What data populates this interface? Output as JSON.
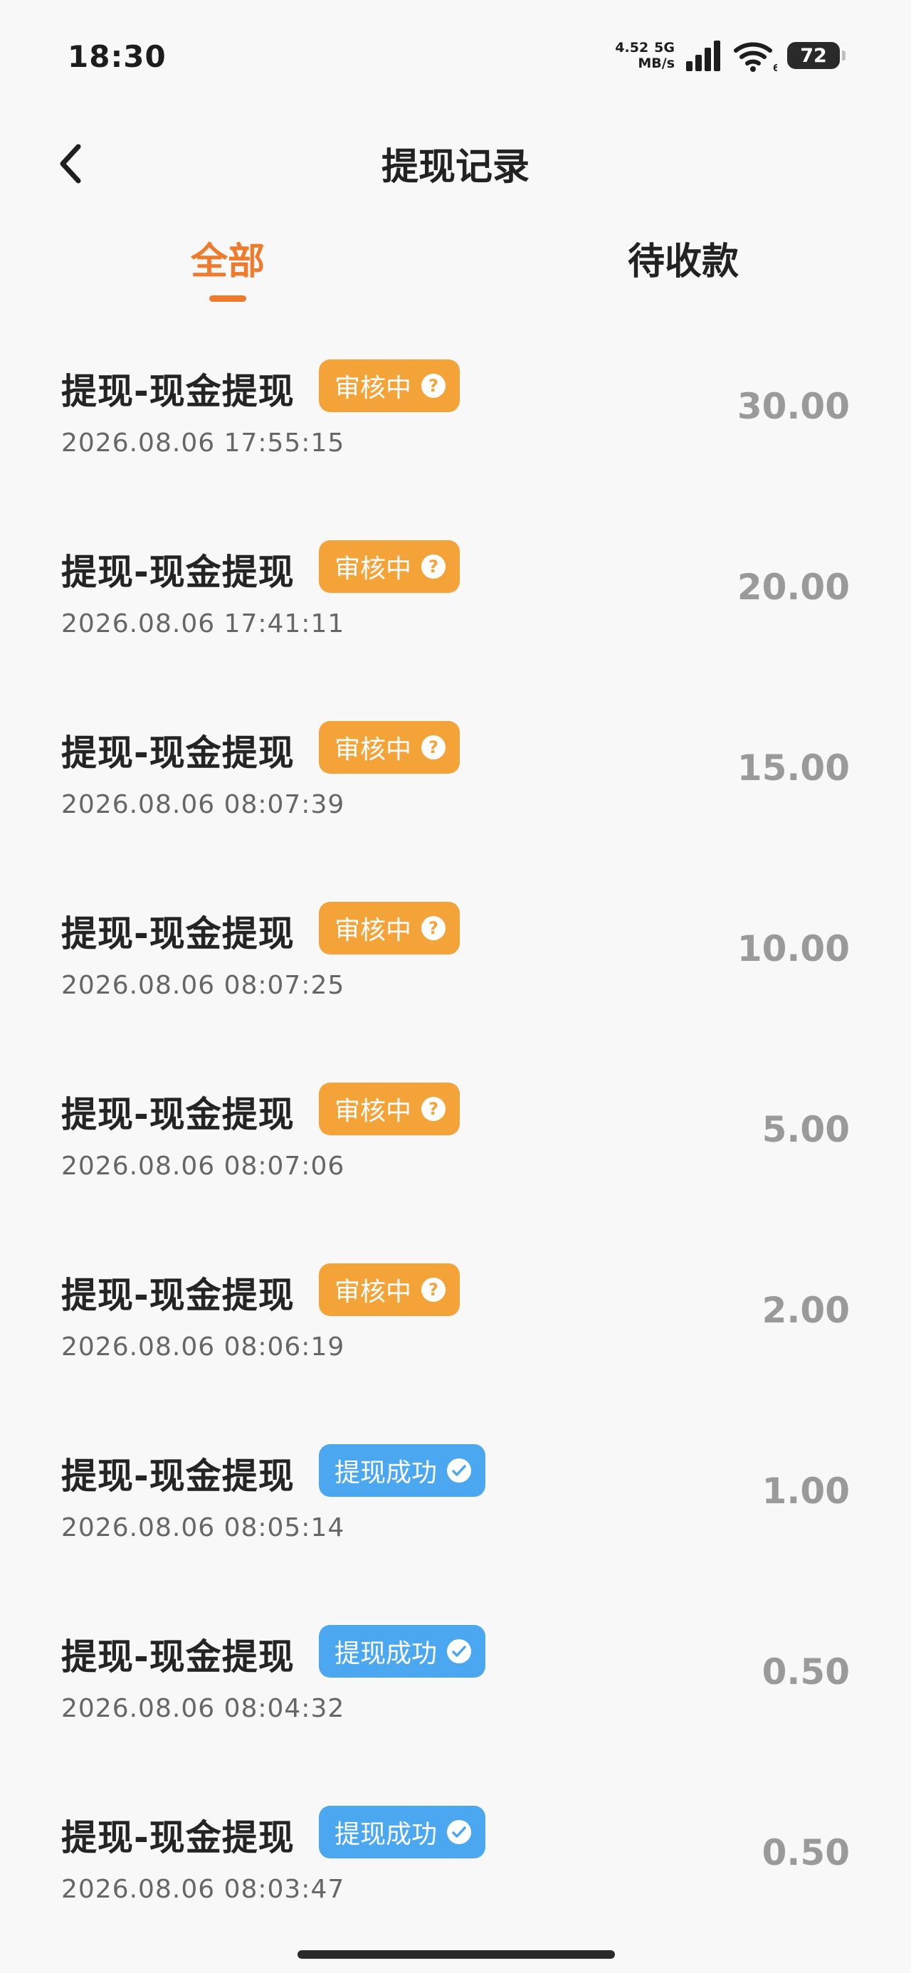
{
  "status_bar": {
    "time": "18:30",
    "net_speed_value": "4.52",
    "net_speed_unit": "MB/s",
    "network_type": "5G",
    "wifi_level": "6",
    "battery": "72"
  },
  "header": {
    "title": "提现记录"
  },
  "tabs": [
    {
      "label": "全部",
      "active": true
    },
    {
      "label": "待收款",
      "active": false
    }
  ],
  "colors": {
    "accent": "#ef7a2c",
    "reviewing": "#f3a338",
    "success": "#4aa7f0"
  },
  "records": [
    {
      "title": "提现-现金提现",
      "status": "审核中",
      "status_icon": "question-icon",
      "time": "2026.08.06 17:55:15",
      "amount": "30.00"
    },
    {
      "title": "提现-现金提现",
      "status": "审核中",
      "status_icon": "question-icon",
      "time": "2026.08.06 17:41:11",
      "amount": "20.00"
    },
    {
      "title": "提现-现金提现",
      "status": "审核中",
      "status_icon": "question-icon",
      "time": "2026.08.06 08:07:39",
      "amount": "15.00"
    },
    {
      "title": "提现-现金提现",
      "status": "审核中",
      "status_icon": "question-icon",
      "time": "2026.08.06 08:07:25",
      "amount": "10.00"
    },
    {
      "title": "提现-现金提现",
      "status": "审核中",
      "status_icon": "question-icon",
      "time": "2026.08.06 08:07:06",
      "amount": "5.00"
    },
    {
      "title": "提现-现金提现",
      "status": "审核中",
      "status_icon": "question-icon",
      "time": "2026.08.06 08:06:19",
      "amount": "2.00"
    },
    {
      "title": "提现-现金提现",
      "status": "提现成功",
      "status_icon": "wechat-pay-icon",
      "time": "2026.08.06 08:05:14",
      "amount": "1.00"
    },
    {
      "title": "提现-现金提现",
      "status": "提现成功",
      "status_icon": "wechat-pay-icon",
      "time": "2026.08.06 08:04:32",
      "amount": "0.50"
    },
    {
      "title": "提现-现金提现",
      "status": "提现成功",
      "status_icon": "wechat-pay-icon",
      "time": "2026.08.06 08:03:47",
      "amount": "0.50"
    }
  ]
}
